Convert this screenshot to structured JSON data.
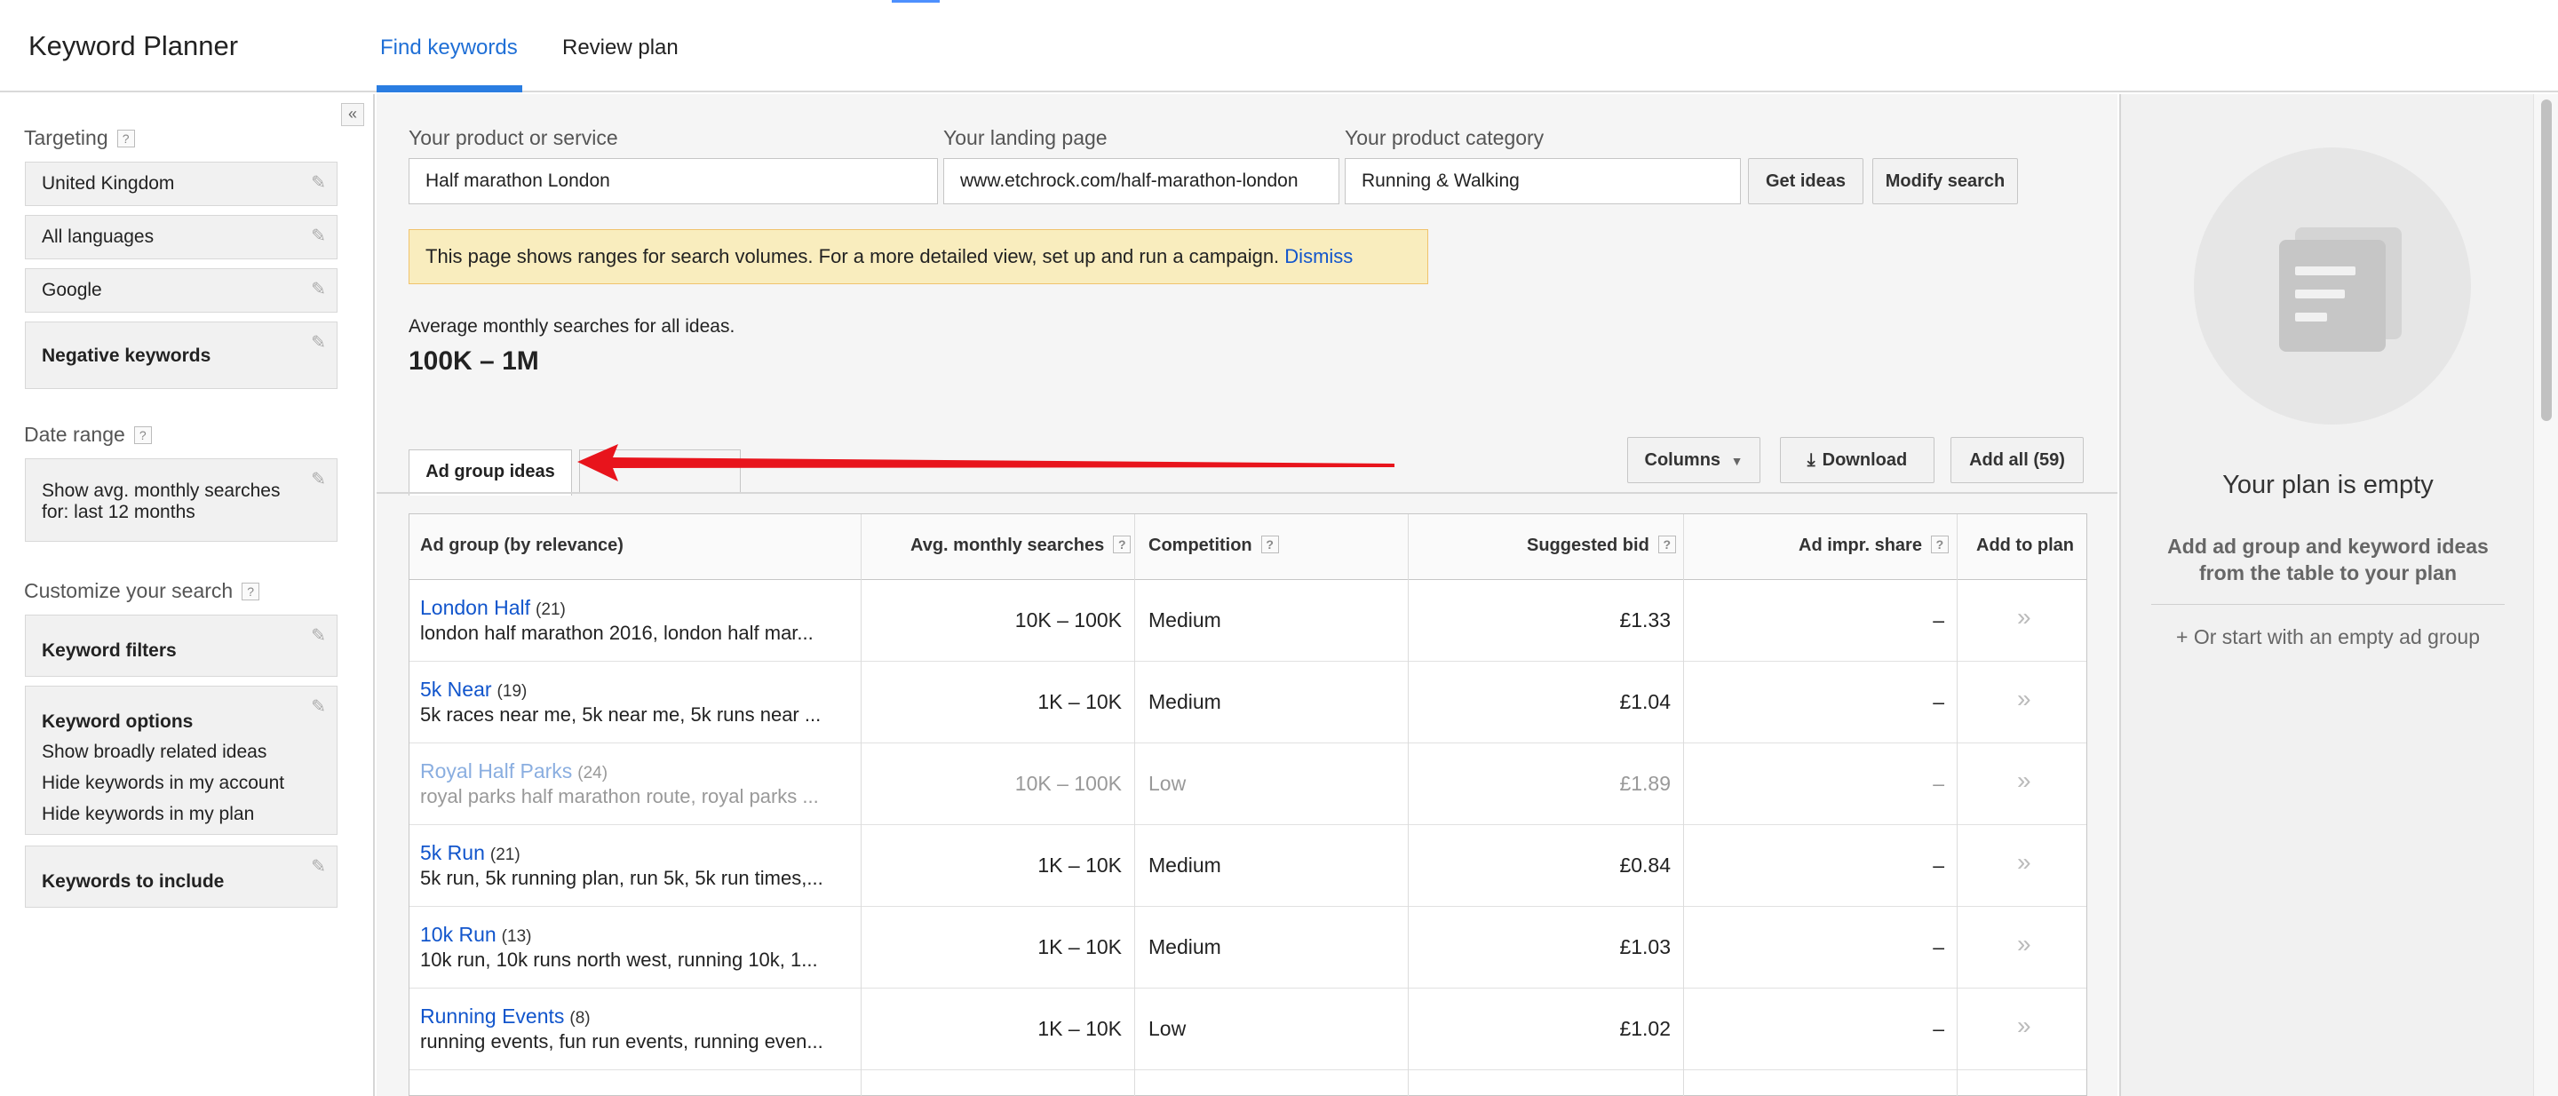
{
  "app": {
    "title": "Keyword Planner"
  },
  "nav": {
    "tabs": [
      {
        "label": "Find keywords",
        "active": true
      },
      {
        "label": "Review plan",
        "active": false
      }
    ]
  },
  "sidebar": {
    "collapse_icon": "«",
    "targeting": {
      "label": "Targeting",
      "help": "?",
      "items": [
        "United Kingdom",
        "All languages",
        "Google",
        "Negative keywords"
      ]
    },
    "date_range": {
      "label": "Date range",
      "help": "?",
      "line1": "Show avg. monthly searches",
      "line2": "for: last 12 months"
    },
    "customize": {
      "label": "Customize your search",
      "help": "?",
      "keyword_filters": "Keyword filters",
      "keyword_options": {
        "title": "Keyword options",
        "lines": [
          "Show broadly related ideas",
          "Hide keywords in my account",
          "Hide keywords in my plan"
        ]
      },
      "keywords_to_include": "Keywords to include"
    }
  },
  "search": {
    "product_label": "Your product or service",
    "product_value": "Half marathon London",
    "landing_label": "Your landing page",
    "landing_value": "www.etchrock.com/half-marathon-london",
    "category_label": "Your product category",
    "category_value": "Running & Walking",
    "get_ideas": "Get ideas",
    "modify_search": "Modify search"
  },
  "notice": {
    "text": "This page shows ranges for search volumes. For a more detailed view, set up and run a campaign.",
    "dismiss": "Dismiss"
  },
  "summary": {
    "label": "Average monthly searches for all ideas.",
    "value": "100K – 1M"
  },
  "results_tabs": {
    "active": "Ad group ideas"
  },
  "toolbar": {
    "columns": "Columns",
    "download": "Download",
    "add_all": "Add all (59)"
  },
  "table": {
    "headers": {
      "group": "Ad group (by relevance)",
      "searches": "Avg. monthly searches",
      "competition": "Competition",
      "bid": "Suggested bid",
      "impr_share": "Ad impr. share",
      "add": "Add to plan"
    },
    "help": "?",
    "rows": [
      {
        "name": "London Half",
        "count": "(21)",
        "keywords": "london half marathon 2016, london half mar...",
        "searches": "10K – 100K",
        "competition": "Medium",
        "bid": "£1.33",
        "impr": "–",
        "add": "»",
        "dim": false
      },
      {
        "name": "5k Near",
        "count": "(19)",
        "keywords": "5k races near me, 5k near me, 5k runs near ...",
        "searches": "1K – 10K",
        "competition": "Medium",
        "bid": "£1.04",
        "impr": "–",
        "add": "»",
        "dim": false
      },
      {
        "name": "Royal Half Parks",
        "count": "(24)",
        "keywords": "royal parks half marathon route, royal parks ...",
        "searches": "10K – 100K",
        "competition": "Low",
        "bid": "£1.89",
        "impr": "–",
        "add": "»",
        "dim": true
      },
      {
        "name": "5k Run",
        "count": "(21)",
        "keywords": "5k run, 5k running plan, run 5k, 5k run times,...",
        "searches": "1K – 10K",
        "competition": "Medium",
        "bid": "£0.84",
        "impr": "–",
        "add": "»",
        "dim": false
      },
      {
        "name": "10k Run",
        "count": "(13)",
        "keywords": "10k run, 10k runs north west, running 10k, 1...",
        "searches": "1K – 10K",
        "competition": "Medium",
        "bid": "£1.03",
        "impr": "–",
        "add": "»",
        "dim": false
      },
      {
        "name": "Running Events",
        "count": "(8)",
        "keywords": "running events, fun run events, running even...",
        "searches": "1K – 10K",
        "competition": "Low",
        "bid": "£1.02",
        "impr": "–",
        "add": "»",
        "dim": false
      }
    ]
  },
  "plan_panel": {
    "title": "Your plan is empty",
    "description": "Add ad group and keyword ideas from the table to your plan",
    "link": "+ Or start with an empty ad group"
  },
  "colors": {
    "accent": "#2a7de1",
    "link": "#1155cc",
    "notice_bg": "#f9edbe",
    "arrow": "#e8141c"
  }
}
